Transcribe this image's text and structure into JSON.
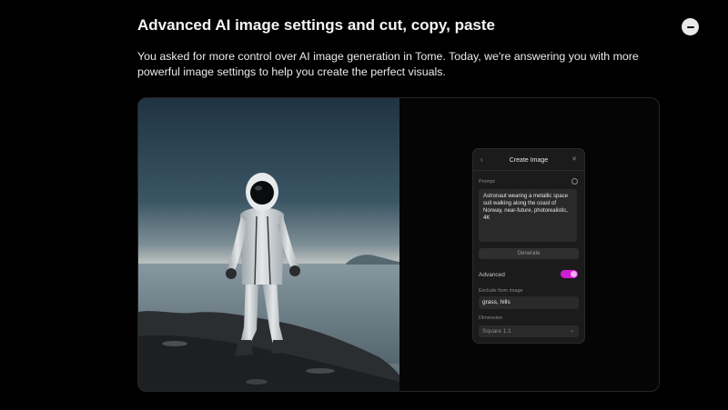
{
  "article": {
    "title": "Advanced AI image settings and cut, copy, paste",
    "description": "You asked for more control over AI image generation in Tome. Today, we're answering you with more powerful image settings to help you create the perfect visuals."
  },
  "icons": {
    "collapse": "minus-icon",
    "back": "chevron-left-icon",
    "close": "close-icon",
    "info": "info-icon",
    "dropdown": "chevron-down-icon"
  },
  "create_image_panel": {
    "title": "Create Image",
    "prompt_label": "Prompt",
    "prompt_value": "Astronaut wearing a metallic space suit walking along the coast of Norway, near-future, photorealistic, 4K",
    "generate_label": "Generate",
    "advanced_label": "Advanced",
    "advanced_enabled": true,
    "exclude_label": "Exclude from image",
    "exclude_value": "grass, hills",
    "dimension_label": "Dimension",
    "dimension_value": "Square 1:1"
  },
  "colors": {
    "background": "#000000",
    "accent_toggle": "#d21cd2",
    "panel": "#1b1b1b"
  }
}
